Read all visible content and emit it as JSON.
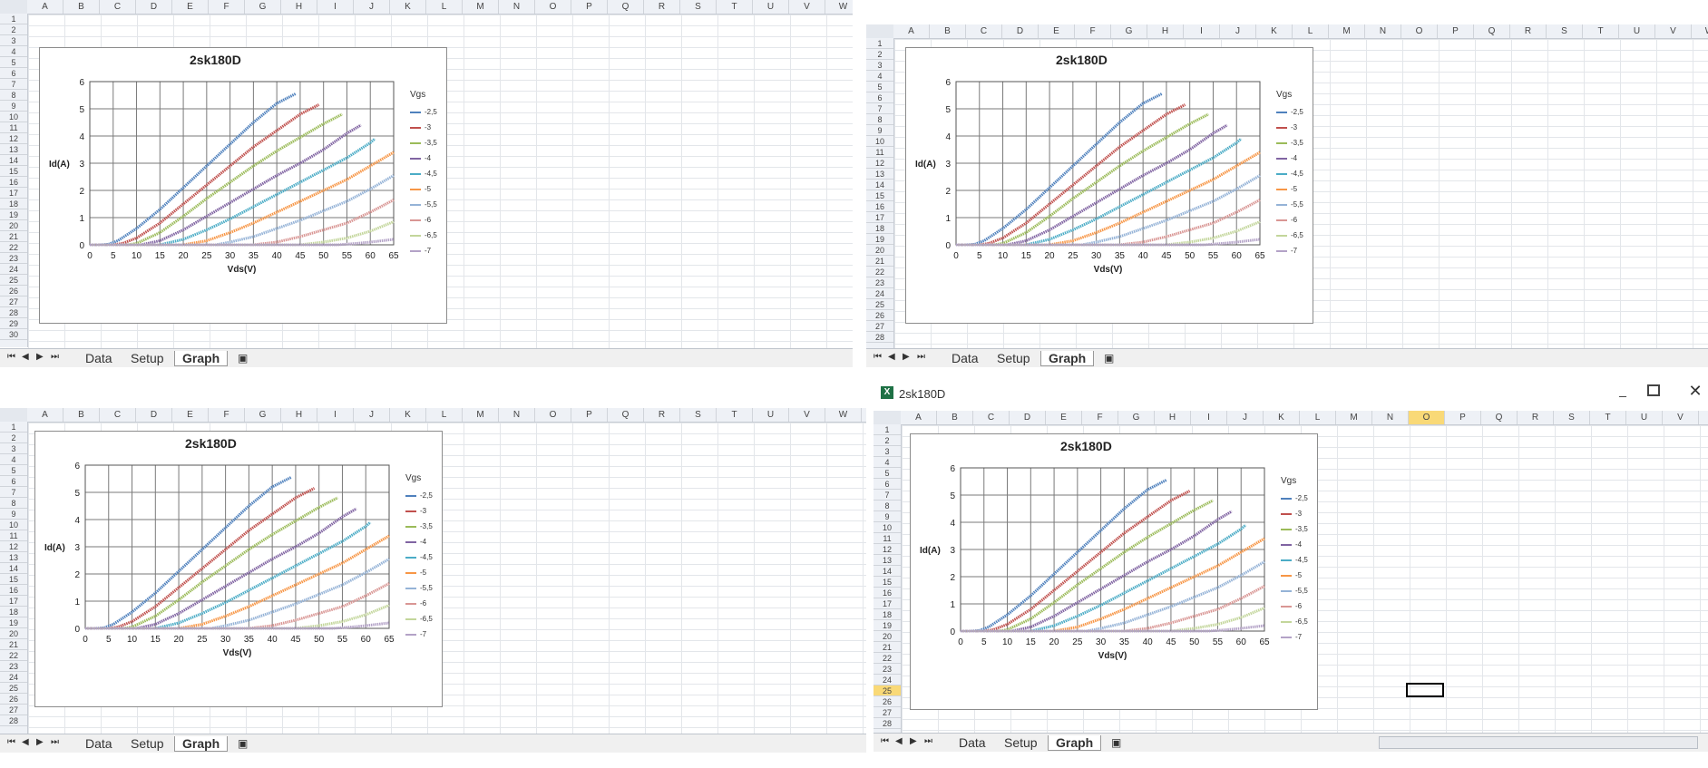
{
  "window_title": "2sk180D",
  "column_headers": [
    "A",
    "B",
    "C",
    "D",
    "E",
    "F",
    "G",
    "H",
    "I",
    "J",
    "K",
    "L",
    "M",
    "N",
    "O",
    "P",
    "Q",
    "R",
    "S",
    "T",
    "U",
    "V",
    "W"
  ],
  "sheet_tabs": [
    "Data",
    "Setup",
    "Graph"
  ],
  "active_tab": "Graph",
  "active_cell": {
    "column": "O",
    "row": 25
  },
  "chart_data": {
    "type": "line",
    "title": "2sk180D",
    "xlabel": "Vds(V)",
    "ylabel": "Id(A)",
    "xlim": [
      0,
      65
    ],
    "ylim": [
      0,
      6
    ],
    "xticks": [
      0,
      5,
      10,
      15,
      20,
      25,
      30,
      35,
      40,
      45,
      50,
      55,
      60,
      65
    ],
    "yticks": [
      0,
      1,
      2,
      3,
      4,
      5,
      6
    ],
    "grid": true,
    "legend_title": "Vgs",
    "legend_position": "right",
    "series": [
      {
        "name": "-2,5",
        "color": "#4f81bd",
        "x": [
          0,
          2,
          4,
          6,
          10,
          15,
          20,
          25,
          30,
          35,
          40,
          44
        ],
        "y": [
          0,
          0,
          0.02,
          0.15,
          0.6,
          1.3,
          2.1,
          2.9,
          3.7,
          4.5,
          5.2,
          5.55
        ]
      },
      {
        "name": "-3",
        "color": "#c0504d",
        "x": [
          0,
          5,
          7,
          10,
          15,
          20,
          25,
          30,
          35,
          40,
          45,
          49
        ],
        "y": [
          0,
          0,
          0.05,
          0.25,
          0.8,
          1.5,
          2.2,
          2.9,
          3.6,
          4.2,
          4.8,
          5.15
        ]
      },
      {
        "name": "-3,5",
        "color": "#9bbb59",
        "x": [
          0,
          8,
          10,
          15,
          20,
          25,
          30,
          35,
          40,
          45,
          50,
          54
        ],
        "y": [
          0,
          0,
          0.05,
          0.45,
          1.05,
          1.7,
          2.3,
          2.9,
          3.45,
          3.95,
          4.45,
          4.8
        ]
      },
      {
        "name": "-4",
        "color": "#8064a2",
        "x": [
          0,
          11,
          15,
          20,
          25,
          30,
          35,
          40,
          45,
          50,
          55,
          58
        ],
        "y": [
          0,
          0,
          0.15,
          0.55,
          1.05,
          1.55,
          2.05,
          2.55,
          3.0,
          3.5,
          4.1,
          4.4
        ]
      },
      {
        "name": "-4,5",
        "color": "#4bacc6",
        "x": [
          0,
          15,
          20,
          25,
          30,
          35,
          40,
          45,
          50,
          55,
          60,
          61
        ],
        "y": [
          0,
          0,
          0.2,
          0.55,
          0.95,
          1.4,
          1.85,
          2.3,
          2.75,
          3.2,
          3.75,
          3.9
        ]
      },
      {
        "name": "-5",
        "color": "#f79646",
        "x": [
          0,
          20,
          25,
          30,
          35,
          40,
          45,
          50,
          55,
          60,
          65
        ],
        "y": [
          0,
          0,
          0.15,
          0.45,
          0.8,
          1.2,
          1.6,
          2.0,
          2.4,
          2.9,
          3.4
        ]
      },
      {
        "name": "-5,5",
        "color": "#95b3d7",
        "x": [
          0,
          27,
          30,
          35,
          40,
          45,
          50,
          55,
          60,
          65
        ],
        "y": [
          0,
          0,
          0.1,
          0.3,
          0.6,
          0.9,
          1.25,
          1.6,
          2.05,
          2.55
        ]
      },
      {
        "name": "-6",
        "color": "#d99694",
        "x": [
          0,
          35,
          40,
          45,
          50,
          55,
          60,
          65
        ],
        "y": [
          0,
          0,
          0.1,
          0.3,
          0.55,
          0.8,
          1.2,
          1.65
        ]
      },
      {
        "name": "-6,5",
        "color": "#c3d69b",
        "x": [
          0,
          45,
          50,
          55,
          60,
          65
        ],
        "y": [
          0,
          0,
          0.1,
          0.25,
          0.5,
          0.85
        ]
      },
      {
        "name": "-7",
        "color": "#b3a2c7",
        "x": [
          0,
          53,
          57,
          60,
          65
        ],
        "y": [
          0,
          0,
          0.05,
          0.1,
          0.2
        ]
      }
    ]
  }
}
